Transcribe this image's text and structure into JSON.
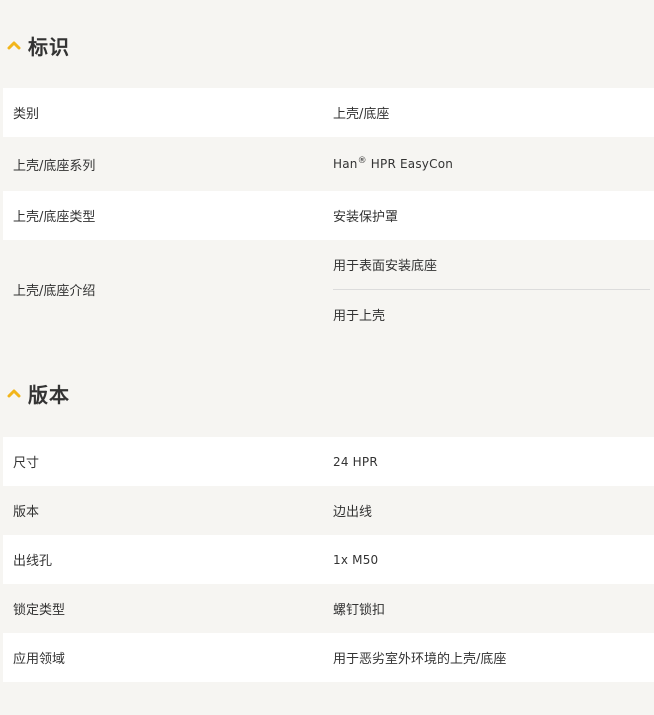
{
  "colors": {
    "accent": "#f2b51b",
    "background": "#f6f5f2",
    "row_white": "#ffffff",
    "text": "#333333"
  },
  "sections": [
    {
      "title": "标识",
      "icon": "chevron-up-icon",
      "rows": [
        {
          "label": "类别",
          "value": "上壳/底座"
        },
        {
          "label": "上壳/底座系列",
          "value_prefix": "Han",
          "value_sup": "®",
          "value_suffix": " HPR EasyCon"
        },
        {
          "label": "上壳/底座类型",
          "value": "安装保护罩"
        },
        {
          "label": "上壳/底座介绍",
          "values": [
            "用于表面安装底座",
            "用于上壳"
          ]
        }
      ]
    },
    {
      "title": "版本",
      "icon": "chevron-up-icon",
      "rows": [
        {
          "label": "尺寸",
          "value": "24 HPR"
        },
        {
          "label": "版本",
          "value": "边出线"
        },
        {
          "label": "出线孔",
          "value": "1x M50"
        },
        {
          "label": "锁定类型",
          "value": "螺钉锁扣"
        },
        {
          "label": "应用领域",
          "value": "用于恶劣室外环境的上壳/底座"
        }
      ]
    }
  ]
}
